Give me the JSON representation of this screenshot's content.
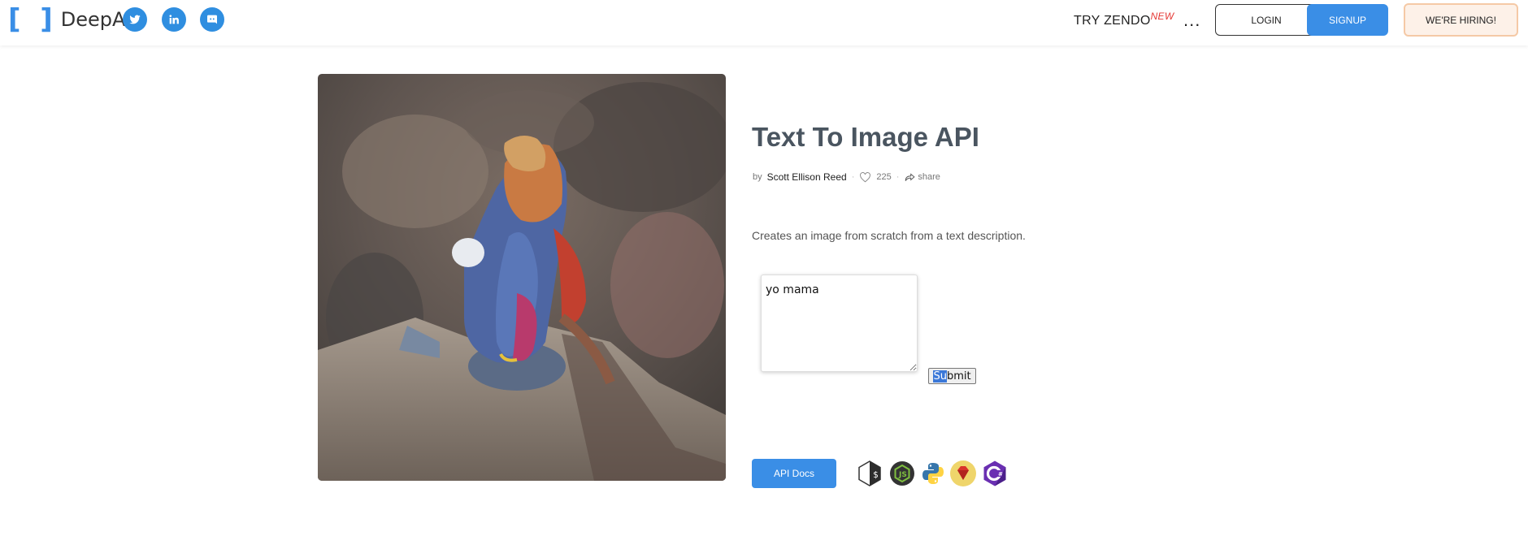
{
  "header": {
    "logo_text": "DeepAI",
    "social_icons": [
      "twitter-icon",
      "linkedin-icon",
      "discord-icon"
    ],
    "try_zendo": "TRY ZENDO",
    "new_badge": "NEW",
    "more_menu": "...",
    "login_label": "LOGIN",
    "signup_label": "SIGNUP",
    "hiring_label": "WE'RE HIRING!"
  },
  "main": {
    "hero_image": "lizard-image",
    "title": "Text To Image API",
    "by_label": "by",
    "author": "Scott Ellison Reed",
    "likes": "225",
    "share_label": "share",
    "description": "Creates an image from scratch from a text description.",
    "prompt_value": "yo mama",
    "submit_selected": "Su",
    "submit_rest": "bmit",
    "api_docs_label": "API Docs",
    "languages": [
      "bash-icon",
      "nodejs-icon",
      "python-icon",
      "ruby-icon",
      "csharp-icon"
    ]
  },
  "colors": {
    "accent": "#3a8ee6",
    "title": "#4a5560",
    "new_badge": "#e53935",
    "hiring_bg": "#fdf1e8",
    "hiring_border": "#f5c9a6"
  }
}
